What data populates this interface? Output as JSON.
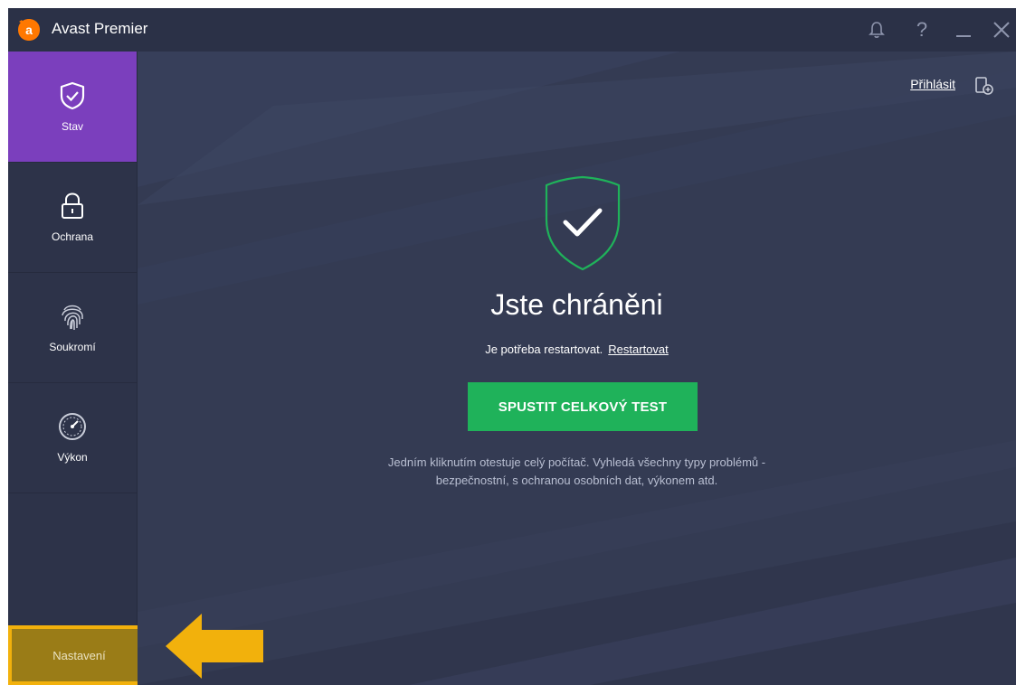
{
  "app": {
    "title": "Avast Premier",
    "logo_icon": "avast-logo-icon",
    "brand_color": "#ff7800"
  },
  "titlebar": {
    "icons": [
      "bell-icon",
      "help-icon",
      "minimize-icon",
      "close-icon"
    ],
    "help_glyph": "?"
  },
  "sidebar": {
    "accent_color": "#7b3fbd",
    "items": [
      {
        "label": "Stav",
        "icon": "shield-check-icon",
        "active": true
      },
      {
        "label": "Ochrana",
        "icon": "lock-icon",
        "active": false
      },
      {
        "label": "Soukromí",
        "icon": "fingerprint-icon",
        "active": false
      },
      {
        "label": "Výkon",
        "icon": "speedometer-icon",
        "active": false
      }
    ],
    "settings_label": "Nastavení",
    "highlight_color": "#f2b10c"
  },
  "header": {
    "signin_label": "Přihlásit",
    "device_icon": "add-device-icon"
  },
  "status": {
    "title": "Jste chráněni",
    "restart_text": "Je potřeba restartovat.",
    "restart_link": "Restartovat",
    "scan_button": "SPUSTIT CELKOVÝ TEST",
    "description_line1": "Jedním kliknutím otestuje celý počítač. Vyhledá všechny typy problémů -",
    "description_line2": "bezpečnostní, s ochranou osobních dat, výkonem atd.",
    "ok_color": "#1fb25a"
  }
}
